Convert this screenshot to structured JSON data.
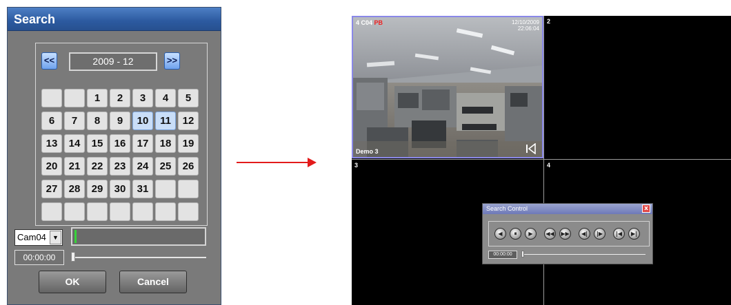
{
  "search_dialog": {
    "title": "Search",
    "month_label": "2009 - 12",
    "prev_label": "<<",
    "next_label": ">>",
    "days": [
      "",
      "",
      "1",
      "2",
      "3",
      "4",
      "5",
      "6",
      "7",
      "8",
      "9",
      "10",
      "11",
      "12",
      "13",
      "14",
      "15",
      "16",
      "17",
      "18",
      "19",
      "20",
      "21",
      "22",
      "23",
      "24",
      "25",
      "26",
      "27",
      "28",
      "29",
      "30",
      "31",
      "",
      "",
      "",
      "",
      "",
      "",
      "",
      "",
      ""
    ],
    "highlighted_days": [
      "10",
      "11"
    ],
    "camera_select": "Cam04",
    "time": "00:00:00",
    "ok_label": "OK",
    "cancel_label": "Cancel"
  },
  "monitor": {
    "cell1": {
      "label": "4 C04",
      "mode": "PB",
      "date": "12/10/2009",
      "time": "22:06:04",
      "caption": "Demo 3"
    },
    "cell2": {
      "label": "2"
    },
    "cell3": {
      "label": "3"
    },
    "cell4": {
      "label": "4"
    }
  },
  "search_control": {
    "title": "Search Control",
    "close_label": "x",
    "time": "00:00:00",
    "buttons": [
      "◀",
      "⏸",
      "▶",
      "◀◀",
      "▶▶",
      "◀|",
      "|▶",
      "|◀",
      "▶|"
    ]
  },
  "colors": {
    "arrow": "#e31b1b",
    "title_bar": "#2c5aa0",
    "highlight_day": "#c9def8",
    "pb": "#e22"
  }
}
